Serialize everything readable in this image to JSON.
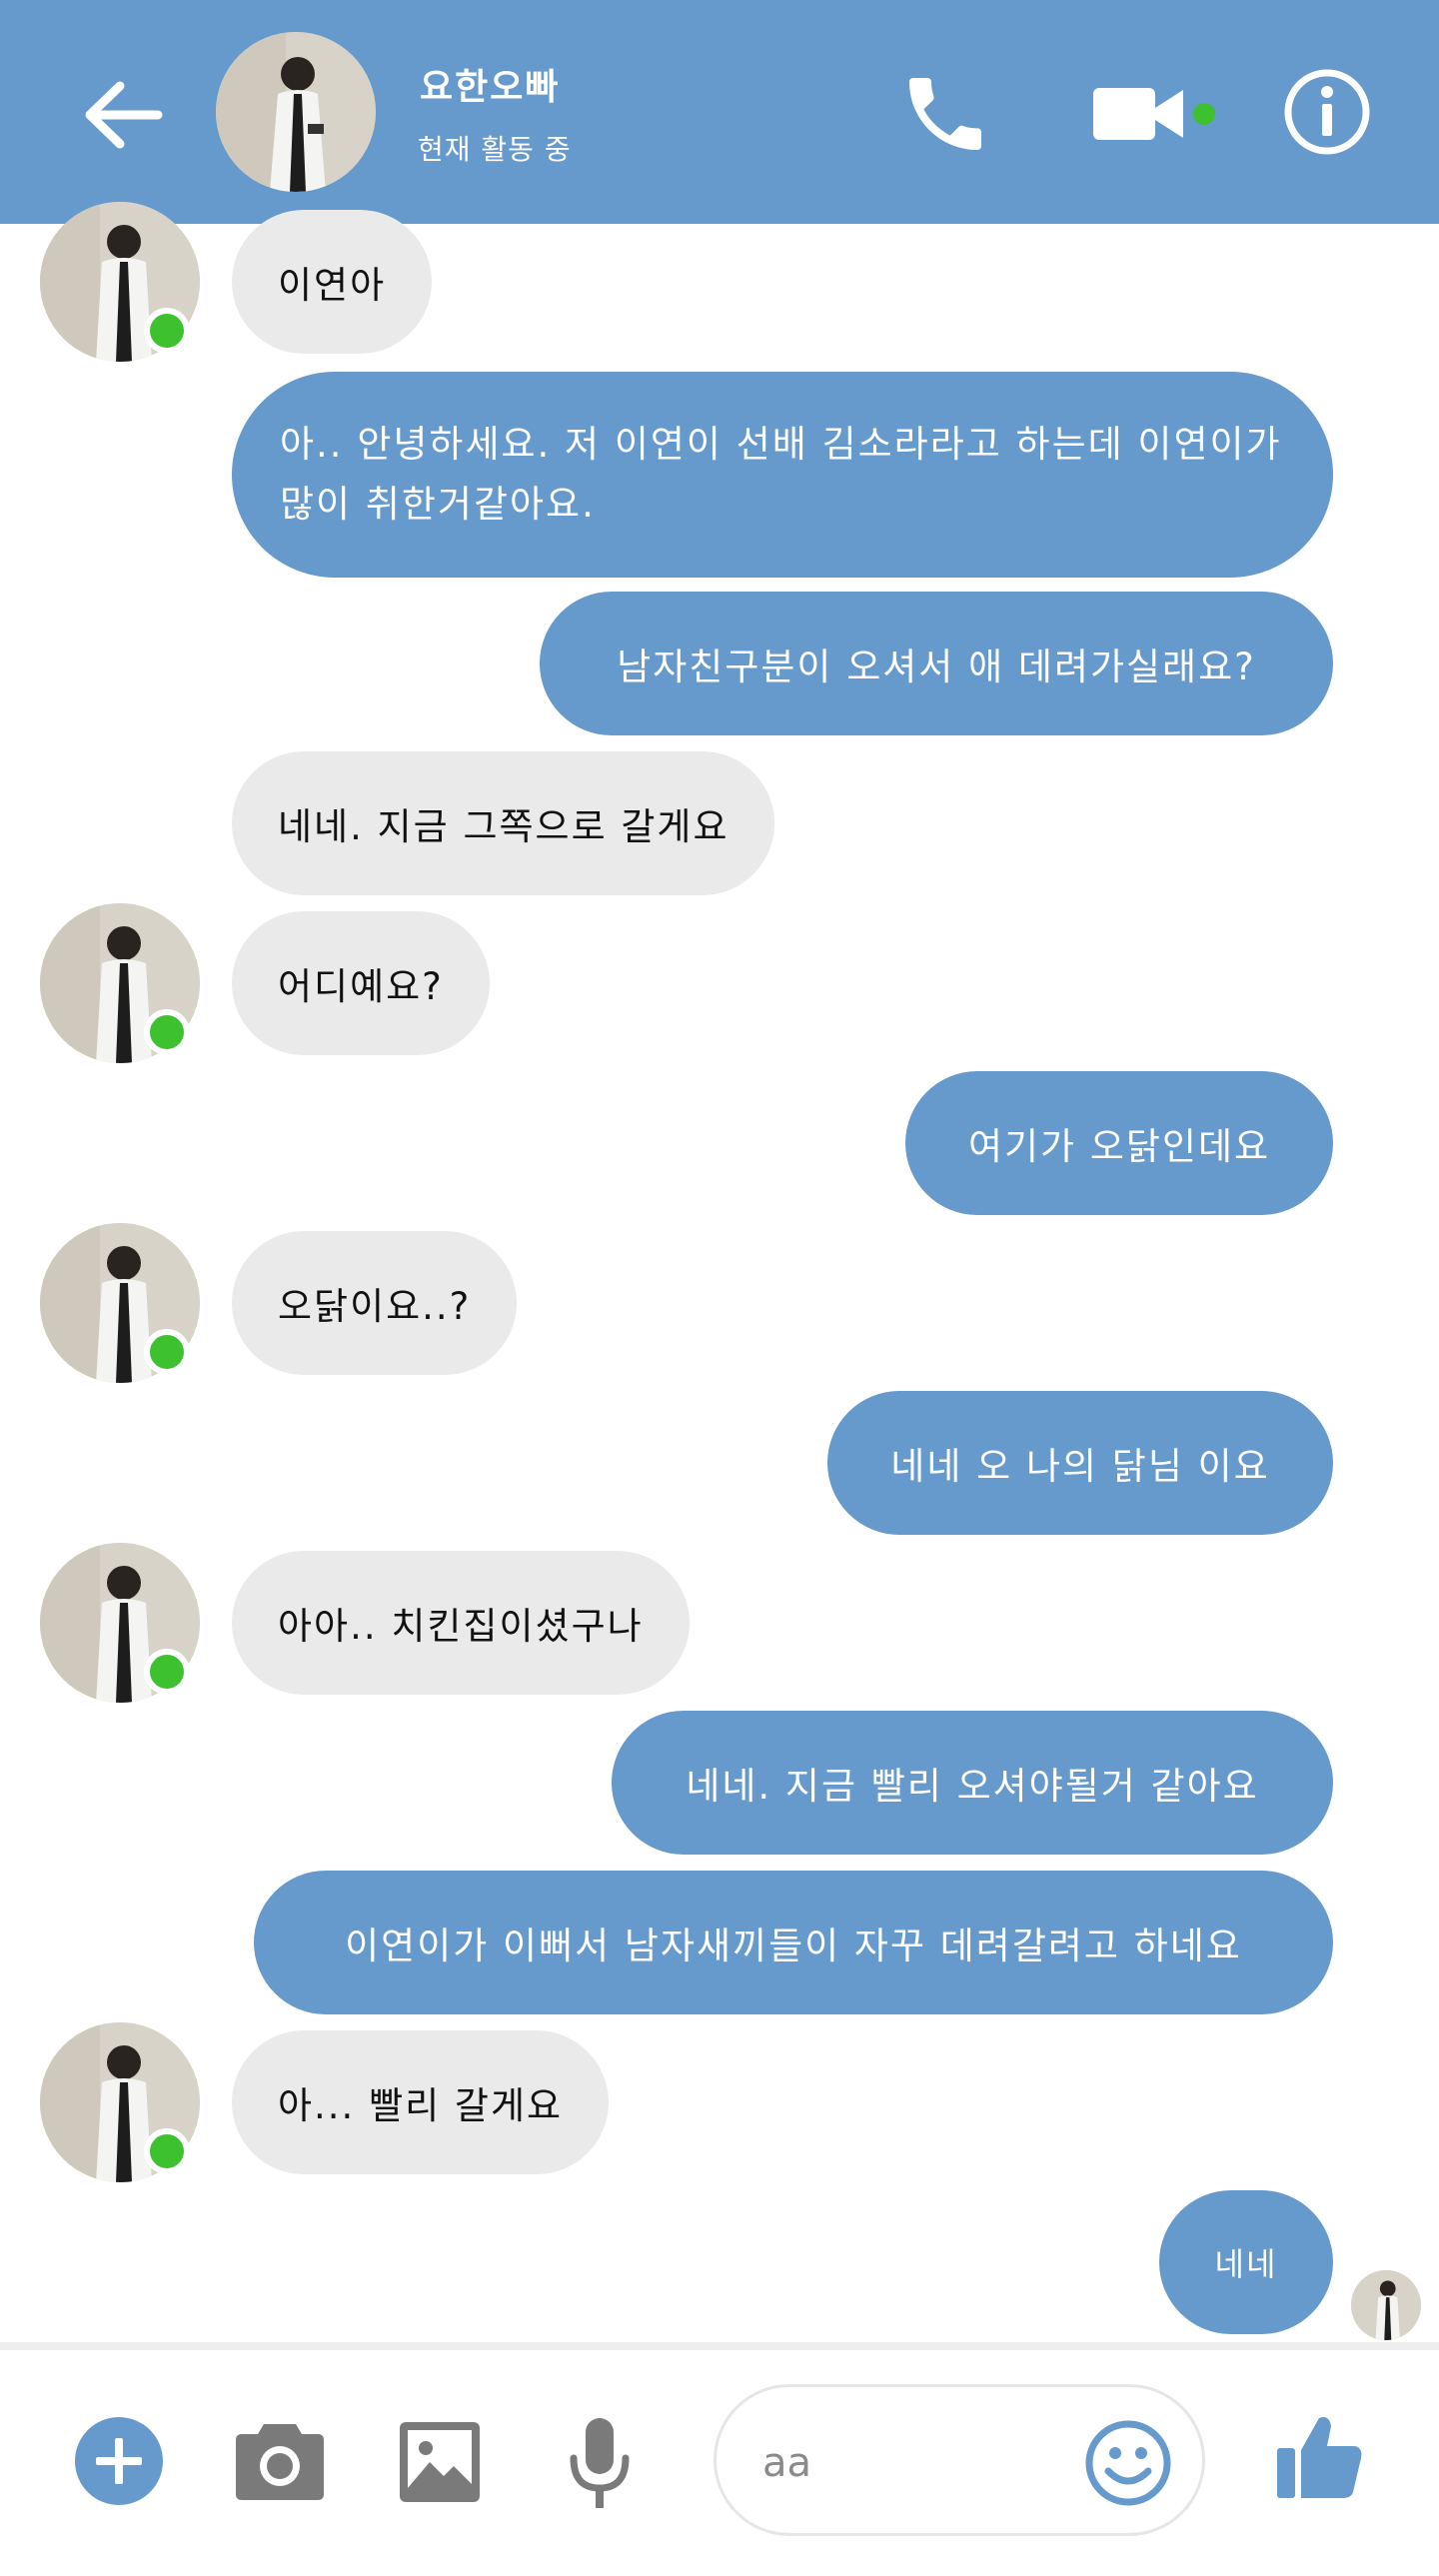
{
  "header": {
    "name": "요한오빠",
    "status": "현재 활동 중",
    "colors": {
      "bar": "#6699cc",
      "online": "#3ec12f"
    },
    "icons": [
      "back-arrow-icon",
      "phone-icon",
      "video-camera-icon",
      "info-icon"
    ]
  },
  "messages": [
    {
      "from": "them",
      "text": "이연아"
    },
    {
      "from": "me",
      "text": "아.. 안녕하세요. 저 이연이 선배 김소라라고 하는데 이연이가 많이 취한거같아요."
    },
    {
      "from": "me",
      "text": "남자친구분이 오셔서 애 데려가실래요?"
    },
    {
      "from": "them",
      "text": "네네. 지금 그쪽으로 갈게요"
    },
    {
      "from": "them",
      "text": "어디예요?"
    },
    {
      "from": "me",
      "text": "여기가 오닭인데요"
    },
    {
      "from": "them",
      "text": "오닭이요..?"
    },
    {
      "from": "me",
      "text": "네네 오 나의 닭님 이요"
    },
    {
      "from": "them",
      "text": "아아.. 치킨집이셨구나"
    },
    {
      "from": "me",
      "text": "네네. 지금 빨리 오셔야될거 같아요"
    },
    {
      "from": "me",
      "text": "이연이가 이뻐서 남자새끼들이 자꾸 데려갈려고 하네요"
    },
    {
      "from": "them",
      "text": "아... 빨리 갈게요"
    },
    {
      "from": "me",
      "text": "네네"
    }
  ],
  "composer": {
    "placeholder": "aa",
    "icons": [
      "add-icon",
      "camera-icon",
      "image-icon",
      "microphone-icon",
      "emoji-icon",
      "thumbs-up-icon"
    ]
  }
}
